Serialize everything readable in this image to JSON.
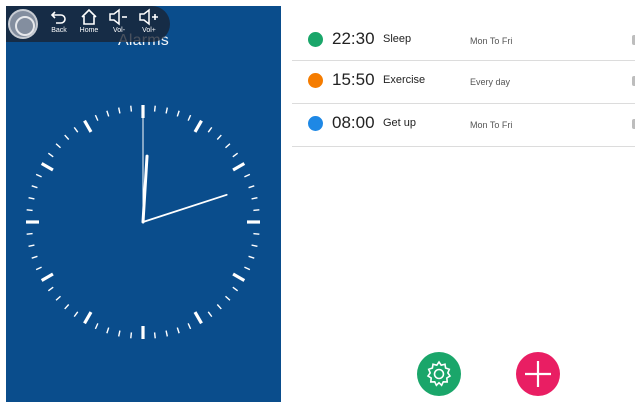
{
  "panel": {
    "title": "Alarms"
  },
  "nav": {
    "back_label": "Back",
    "home_label": "Home",
    "vol_down_label": "Vol-",
    "vol_up_label": "Vol+"
  },
  "clock": {
    "hour": 12,
    "minute": 7
  },
  "alarms": [
    {
      "time": "22:30",
      "name": "Sleep",
      "repeat": "Mon To Fri",
      "color": "#1aa66a"
    },
    {
      "time": "15:50",
      "name": "Exercise",
      "repeat": "Every day",
      "color": "#f57c00"
    },
    {
      "time": "08:00",
      "name": "Get up",
      "repeat": "Mon To Fri",
      "color": "#1e88e5"
    }
  ],
  "actions": {
    "settings_icon": "gear-icon",
    "add_icon": "plus-icon",
    "settings_color": "#1aa66a",
    "add_color": "#e91e63"
  }
}
